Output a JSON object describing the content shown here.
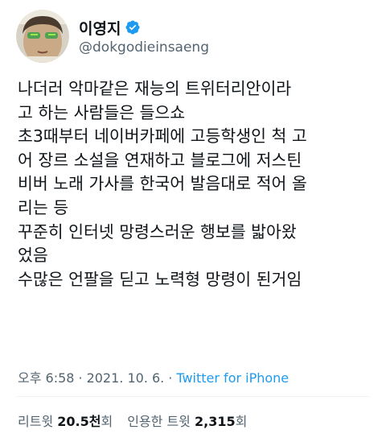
{
  "user": {
    "display_name": "이영지",
    "handle": "@dokgodieinsaeng",
    "verified_icon": "verified-badge-icon",
    "verified_color": "#1d9bf0"
  },
  "tweet": {
    "lines": [
      "나더러 악마같은 재능의 트위터리안이라",
      "고 하는 사람들은 들으쇼",
      "초3때부터 네이버카페에 고등학생인 척 고",
      "어 장르 소설을 연재하고 블로그에 저스틴",
      "비버 노래 가사를 한국어 발음대로 적어 올",
      "리는 등",
      "꾸준히 인터넷 망령스러운 행보를 밟아왔",
      "었음",
      "수많은 언팔을 딛고 노력형 망령이 된거임"
    ]
  },
  "meta": {
    "time": "오후 6:58",
    "separator": "·",
    "date": "2021. 10. 6.",
    "source": "Twitter for iPhone"
  },
  "stats": {
    "retweets_label": "리트윗",
    "retweets_count": "20.5천",
    "retweets_unit": "회",
    "quotes_label": "인용한 트윗",
    "quotes_count": "2,315",
    "quotes_unit": "회"
  },
  "colors": {
    "text": "#0f1419",
    "secondary": "#536471",
    "accent": "#1d9bf0",
    "divider": "#eff3f4"
  }
}
